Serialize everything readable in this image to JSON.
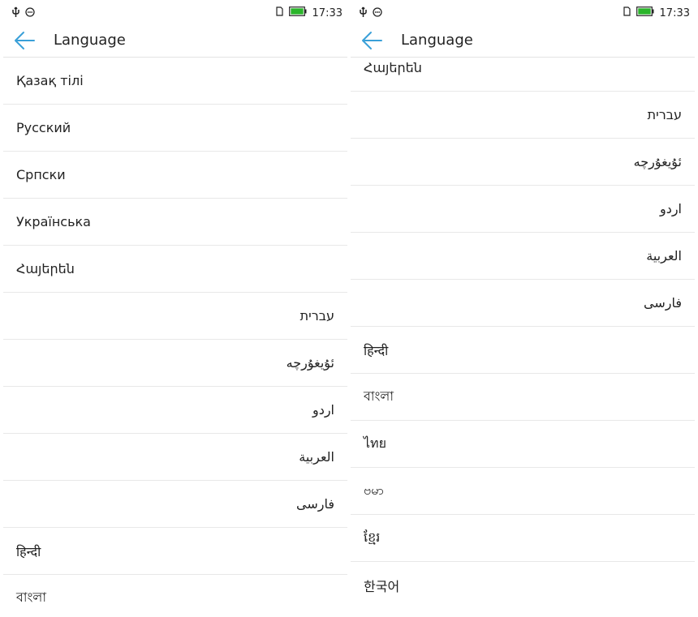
{
  "status_bar": {
    "time": "17:33",
    "left_icons": [
      "usb-icon",
      "sync-icon"
    ],
    "right_icons": [
      "sim-icon",
      "battery-icon"
    ],
    "battery_color": "#2bb52b"
  },
  "app_bar": {
    "title": "Language",
    "back_icon": "arrow-left-icon",
    "accent_color": "#3aa0d8"
  },
  "left_screen": {
    "languages": [
      {
        "label": "Қазақ тілі",
        "rtl": false
      },
      {
        "label": "Русский",
        "rtl": false
      },
      {
        "label": "Српски",
        "rtl": false
      },
      {
        "label": "Українська",
        "rtl": false
      },
      {
        "label": "Հայերեն",
        "rtl": false
      },
      {
        "label": "עברית",
        "rtl": true
      },
      {
        "label": "ئۇيغۇرچە",
        "rtl": true
      },
      {
        "label": "اردو",
        "rtl": true
      },
      {
        "label": "العربية",
        "rtl": true
      },
      {
        "label": "فارسی",
        "rtl": true
      },
      {
        "label": "हिन्दी",
        "rtl": false
      },
      {
        "label": "বাংলা",
        "rtl": false
      }
    ]
  },
  "right_screen": {
    "languages": [
      {
        "label": "Հայերեն",
        "rtl": false
      },
      {
        "label": "עברית",
        "rtl": true
      },
      {
        "label": "ئۇيغۇرچە",
        "rtl": true
      },
      {
        "label": "اردو",
        "rtl": true
      },
      {
        "label": "العربية",
        "rtl": true
      },
      {
        "label": "فارسی",
        "rtl": true
      },
      {
        "label": "हिन्दी",
        "rtl": false
      },
      {
        "label": "বাংলা",
        "rtl": false
      },
      {
        "label": "ไทย",
        "rtl": false
      },
      {
        "label": "ဗမာ",
        "rtl": false
      },
      {
        "label": "ខ្មែរ",
        "rtl": false
      },
      {
        "label": "한국어",
        "rtl": false
      }
    ]
  }
}
